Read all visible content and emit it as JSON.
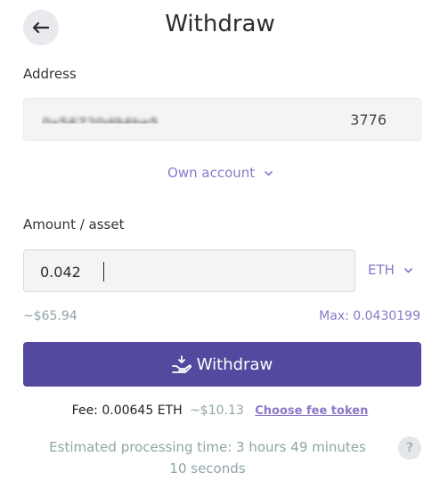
{
  "header": {
    "title": "Withdraw",
    "back_icon": "arrow-left-icon"
  },
  "address": {
    "label": "Address",
    "value_start": "0x56720d94be5",
    "value_end": "3776"
  },
  "own_account": {
    "label": "Own account",
    "icon": "chevron-down-icon"
  },
  "amount": {
    "label": "Amount / asset",
    "value": "0.042",
    "asset": "ETH",
    "usd_estimate": "~$65.94",
    "max_label": "Max: 0.0430199"
  },
  "withdraw_button": {
    "label": "Withdraw",
    "icon": "hand-coin-icon"
  },
  "fee": {
    "text": "Fee: 0.00645 ETH",
    "usd": "~$10.13",
    "choose_token": "Choose fee token"
  },
  "estimate": {
    "text": "Estimated processing time: 3 hours 49 minutes 10 seconds",
    "help": "?"
  },
  "colors": {
    "accent": "#53499e",
    "link": "#8a78c9",
    "muted": "#8fa4a6"
  }
}
